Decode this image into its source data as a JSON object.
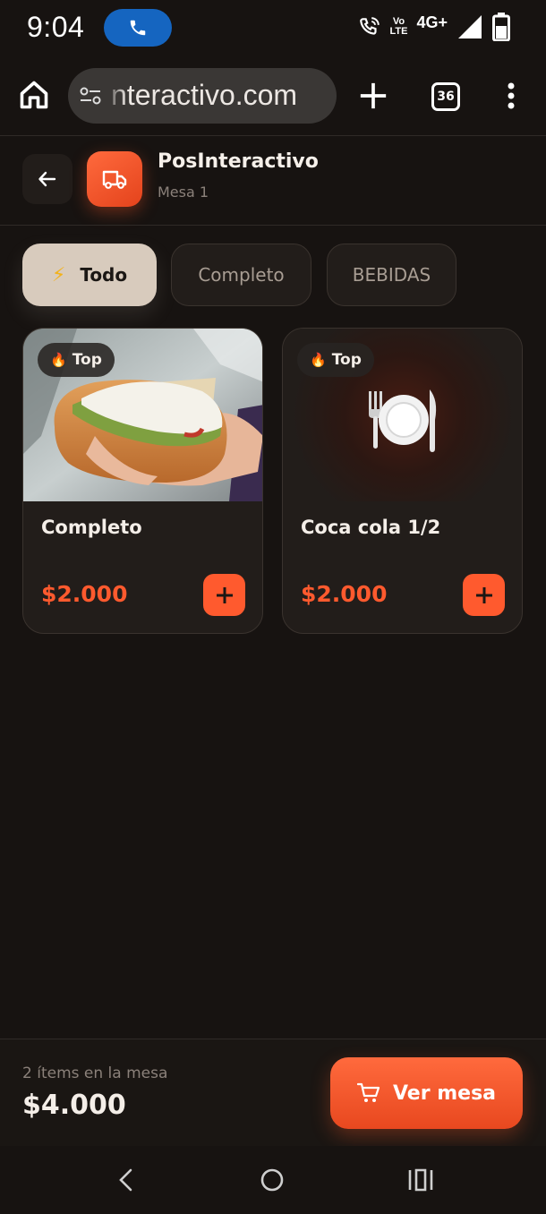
{
  "status_bar": {
    "time": "9:04",
    "volte_top": "Vo",
    "volte_bottom": "LTE",
    "network": "4G+"
  },
  "browser": {
    "url": "nteractivo.com",
    "tab_count": "36"
  },
  "header": {
    "title": "PosInteractivo",
    "subtitle": "Mesa 1"
  },
  "categories": [
    {
      "label": "Todo",
      "active": true
    },
    {
      "label": "Completo",
      "active": false
    },
    {
      "label": "BEBIDAS",
      "active": false
    }
  ],
  "products": [
    {
      "badge": "Top",
      "name": "Completo",
      "price": "$2.000"
    },
    {
      "badge": "Top",
      "name": "Coca cola 1/2",
      "price": "$2.000"
    }
  ],
  "cart": {
    "items_text": "2 ítems en la mesa",
    "total": "$4.000",
    "button_label": "Ver mesa"
  },
  "colors": {
    "accent": "#ff5a2e",
    "background": "#171311",
    "active_chip": "#d8cbbd"
  }
}
